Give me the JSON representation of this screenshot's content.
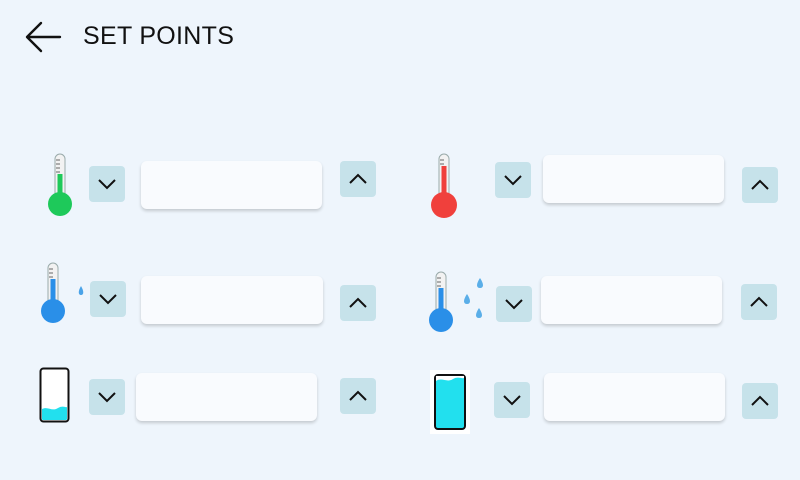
{
  "header": {
    "title": "SET POINTS",
    "back_icon": "arrow-left-icon"
  },
  "setpoints": [
    {
      "name": "temperature-low",
      "icon": "thermometer-green-icon",
      "value": "",
      "color": "#1ec95a"
    },
    {
      "name": "temperature-high",
      "icon": "thermometer-red-icon",
      "value": "",
      "color": "#f0403c"
    },
    {
      "name": "temperature-humidity-low",
      "icon": "thermometer-blue-droplet-icon",
      "value": "",
      "color": "#2a8fe8"
    },
    {
      "name": "temperature-humidity-high",
      "icon": "thermometer-blue-droplets-icon",
      "value": "",
      "color": "#2a8fe8"
    },
    {
      "name": "level-low",
      "icon": "tank-low-icon",
      "value": "",
      "color": "#22e0ee"
    },
    {
      "name": "level-high",
      "icon": "tank-full-icon",
      "value": "",
      "color": "#22e0ee"
    }
  ],
  "colors": {
    "background": "#eef5fc",
    "button": "#c6e2ea",
    "field": "#f9fbfe"
  }
}
